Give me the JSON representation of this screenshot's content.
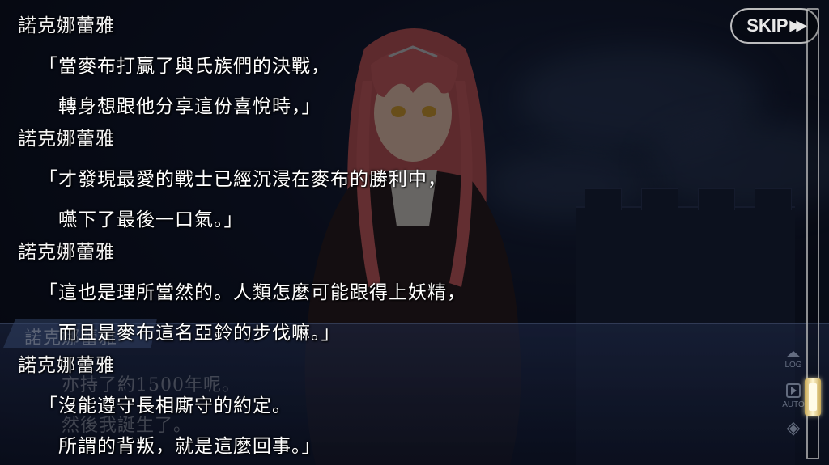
{
  "skip_button": {
    "label": "SKIP",
    "icon": "fast-forward-icon"
  },
  "background_dialogue": {
    "speaker": "諾克娜蕾雅",
    "lines": [
      "亦持了約1500年呢。",
      "然後我誕生了。"
    ]
  },
  "side_controls": {
    "log_label": "LOG",
    "auto_label": "AUTO"
  },
  "log_entries": [
    {
      "speaker": "諾克娜蕾雅",
      "lines": [
        "「當麥布打贏了與氏族們的決戰，",
        "轉身想跟他分享這份喜悅時，」"
      ]
    },
    {
      "speaker": "諾克娜蕾雅",
      "lines": [
        "「才發現最愛的戰士已經沉浸在麥布的勝利中，",
        "嚥下了最後一口氣。」"
      ]
    },
    {
      "speaker": "諾克娜蕾雅",
      "lines": [
        "「這也是理所當然的。人類怎麼可能跟得上妖精，",
        "而且是麥布這名亞鈴的步伐嘛。」"
      ]
    },
    {
      "speaker": "諾克娜蕾雅",
      "lines": [
        "「沒能遵守長相廝守的約定。",
        "所謂的背叛，就是這麼回事。」"
      ]
    }
  ],
  "scrollbar": {
    "position_fraction": 0.9
  }
}
